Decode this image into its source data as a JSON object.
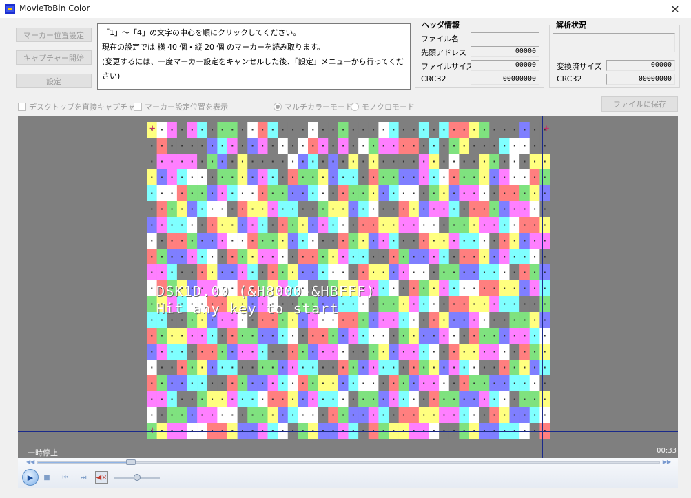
{
  "window": {
    "title": "MovieToBin Color"
  },
  "buttons": {
    "marker_setup": "マーカー位置設定",
    "capture_start": "キャプチャー開始",
    "settings": "設定",
    "save_file": "ファイルに保存"
  },
  "instructions": [
    "「1」～「4」の文字の中心を順にクリックしてください。",
    "現在の設定では 横 40 個・縦 20 個 のマーカーを読み取ります。",
    "(変更するには、一度マーカー設定をキャンセルした後、「設定」メニューから行ってください)"
  ],
  "header_info": {
    "title": "ヘッダ情報",
    "rows": [
      {
        "label": "ファイル名",
        "value": ""
      },
      {
        "label": "先頭アドレス",
        "value": "00000"
      },
      {
        "label": "ファイルサイズ",
        "value": "00000"
      },
      {
        "label": "CRC32",
        "value": "00000000"
      }
    ]
  },
  "analysis": {
    "title": "解析状況",
    "status": "",
    "rows": [
      {
        "label": "変換済サイズ",
        "value": "00000"
      },
      {
        "label": "CRC32",
        "value": "00000000"
      }
    ]
  },
  "options": {
    "desktop_capture": "デスクトップを直接キャプチャー",
    "show_marker_pos": "マーカー設定位置を表示",
    "multicolor_mode": "マルチカラーモード",
    "mono_mode": "モノクロモード",
    "multicolor_selected": true
  },
  "video": {
    "screen_line1": "DSK1D.00 (&H8000-&HBFFF)",
    "screen_line2": "Hit any key to start",
    "status": "一時停止",
    "time": "00:33",
    "seek_progress": 0.15,
    "volume": 0.5
  },
  "colors": {
    "palette": [
      "#ff7f7f",
      "#7fe27f",
      "#ffff7f",
      "#7f7fff",
      "#ff7fff",
      "#7fffff",
      "#ffffff",
      "#7f7f7f"
    ],
    "video_bg": "#7f7f7f",
    "crosshair": "#1a2a8a"
  },
  "icons": {
    "app": "app-icon",
    "close": "close-icon",
    "play": "play-icon",
    "stop": "stop-icon",
    "prev": "prev-icon",
    "next": "next-icon",
    "mute": "mute-icon"
  }
}
